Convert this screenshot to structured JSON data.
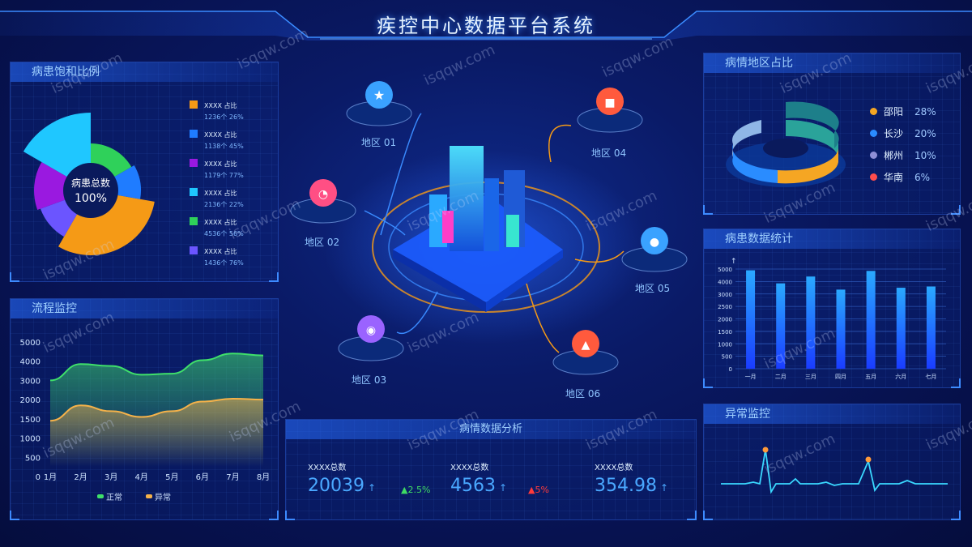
{
  "title": "疾控中心数据平台系统",
  "watermark": "isqqw.com",
  "panels": {
    "saturation": {
      "title": "病患饱和比例",
      "center_label": "病患总数",
      "center_value": "100%"
    },
    "process": {
      "title": "流程监控"
    },
    "region_share": {
      "title": "病情地区占比"
    },
    "patient_stats": {
      "title": "病患数据统计"
    },
    "anomaly": {
      "title": "异常监控"
    },
    "analysis": {
      "title": "病情数据分析"
    }
  },
  "saturation_legend": [
    {
      "label": "XXXX 占比",
      "detail": "1236个 26%",
      "color": "#f59a16"
    },
    {
      "label": "XXXX 占比",
      "detail": "1138个 45%",
      "color": "#1f7cff"
    },
    {
      "label": "XXXX 占比",
      "detail": "1179个 77%",
      "color": "#9a19e0"
    },
    {
      "label": "XXXX 占比",
      "detail": "2136个 22%",
      "color": "#1fc7ff"
    },
    {
      "label": "XXXX 占比",
      "detail": "4536个 56%",
      "color": "#2fd15a"
    },
    {
      "label": "XXXX 占比",
      "detail": "1436个 76%",
      "color": "#6b55ff"
    }
  ],
  "region_legend": [
    {
      "name": "邵阳",
      "pct": "28%",
      "color": "#f5a623"
    },
    {
      "name": "长沙",
      "pct": "20%",
      "color": "#2a8cff"
    },
    {
      "name": "郴州",
      "pct": "10%",
      "color": "#8f8fd6"
    },
    {
      "name": "华南",
      "pct": "6%",
      "color": "#ff4d4d"
    }
  ],
  "regions": [
    "地区 01",
    "地区 02",
    "地区 03",
    "地区 04",
    "地区 05",
    "地区 06"
  ],
  "stats": [
    {
      "label": "XXXX总数",
      "value": "20039",
      "arrow": "↑"
    },
    {
      "label": "XXXX总数",
      "value": "4563",
      "arrow": "↑"
    },
    {
      "label": "XXXX总数",
      "value": "354.98",
      "arrow": "↑"
    }
  ],
  "changes": [
    {
      "text": "▲2.5%",
      "color": "#3fdc63"
    },
    {
      "text": "▲5%",
      "color": "#ff3a3a"
    }
  ],
  "chart_data": [
    {
      "type": "area",
      "x": [
        "1月",
        "2月",
        "3月",
        "4月",
        "5月",
        "6月",
        "7月",
        "8月"
      ],
      "ylim": [
        0,
        5000
      ],
      "yticks": [
        "0",
        "500",
        "1000",
        "1500",
        "2000",
        "3000",
        "4000",
        "5000"
      ],
      "series": [
        {
          "name": "正常",
          "values": [
            3000,
            3850,
            3750,
            3300,
            3350,
            4050,
            4400,
            4300
          ],
          "color": "#3fe06a"
        },
        {
          "name": "异常",
          "values": [
            1450,
            1850,
            1700,
            1550,
            1700,
            1950,
            2050,
            2000
          ],
          "color": "#f5b24a"
        }
      ]
    },
    {
      "type": "bar",
      "categories": [
        "一月",
        "二月",
        "三月",
        "四月",
        "五月",
        "六月",
        "七月"
      ],
      "values": [
        4900,
        3850,
        4400,
        3350,
        4850,
        3500,
        3600
      ],
      "ylim": [
        0,
        5000
      ],
      "yticks": [
        "0",
        "500",
        "1000",
        "1500",
        "2000",
        "2500",
        "3000",
        "4000",
        "5000"
      ],
      "axis_arrow": "↑"
    }
  ]
}
